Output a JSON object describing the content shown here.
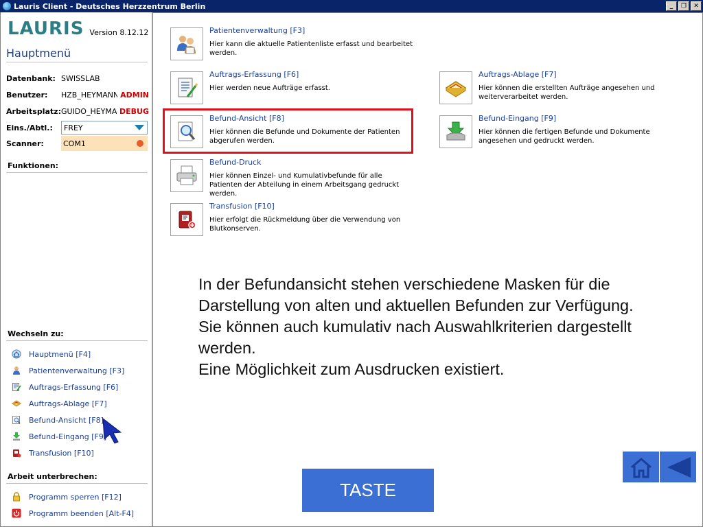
{
  "window": {
    "title": "Lauris Client - Deutsches Herzzentrum Berlin",
    "buttons": [
      "_",
      "❐",
      "✕"
    ]
  },
  "sidebar": {
    "logo": "LAURIS",
    "version": "Version 8.12.12",
    "heading": "Hauptmenü",
    "info": {
      "datenbank_label": "Datenbank:",
      "datenbank_value": "SWISSLAB",
      "benutzer_label": "Benutzer:",
      "benutzer_value": "HZB_HEYMANNG",
      "benutzer_badge": "ADMIN",
      "arbeitsplatz_label": "Arbeitsplatz:",
      "arbeitsplatz_value": "GUIDO_HEYMAN",
      "arbeitsplatz_badge": "DEBUG",
      "eins_label": "Eins./Abtl.:",
      "eins_value": "FREY",
      "scanner_label": "Scanner:",
      "scanner_value": "COM1"
    },
    "funktionen_label": "Funktionen:",
    "wechseln_label": "Wechseln zu:",
    "wechseln_items": [
      "Hauptmenü [F4]",
      "Patientenverwaltung [F3]",
      "Auftrags-Erfassung [F6]",
      "Auftrags-Ablage [F7]",
      "Befund-Ansicht [F8]",
      "Befund-Eingang [F9]",
      "Transfusion [F10]"
    ],
    "unterbrechen_label": "Arbeit unterbrechen:",
    "unterbrechen_items": [
      "Programm sperren [F12]",
      "Programm beenden [Alt-F4]"
    ]
  },
  "main": {
    "tiles": {
      "patientenverwaltung": {
        "title": "Patientenverwaltung [F3]",
        "desc": "Hier kann die aktuelle Patientenliste erfasst und bearbeitet werden."
      },
      "auftrags_erfassung": {
        "title": "Auftrags-Erfassung [F6]",
        "desc": "Hier werden neue Aufträge erfasst."
      },
      "auftrags_ablage": {
        "title": "Auftrags-Ablage [F7]",
        "desc": "Hier können die erstellten Aufträge angesehen und weiterverarbeitet werden."
      },
      "befund_ansicht": {
        "title": "Befund-Ansicht [F8]",
        "desc": "Hier können die Befunde und Dokumente der Patienten abgerufen werden."
      },
      "befund_eingang": {
        "title": "Befund-Eingang [F9]",
        "desc": "Hier können die fertigen Befunde und Dokumente angesehen und gedruckt werden."
      },
      "befund_druck": {
        "title": "Befund-Druck",
        "desc": "Hier können Einzel- und Kumulativbefunde für alle Patienten der Abteilung in einem Arbeitsgang gedruckt werden."
      },
      "transfusion": {
        "title": "Transfusion [F10]",
        "desc": "Hier erfolgt die Rückmeldung über die Verwendung von Blutkonserven."
      }
    },
    "overlay_lines": [
      "In der Befundansicht stehen verschiedene Masken für die",
      "Darstellung von alten und aktuellen Befunden zur Verfügung.",
      "Sie können auch kumulativ nach Auswahlkriterien dargestellt",
      "werden.",
      "Eine Möglichkeit zum Ausdrucken existiert."
    ],
    "taste_label": "TASTE"
  },
  "colors": {
    "accent": "#3b6fd4",
    "highlight": "#e0101a",
    "link": "#1a3f9a"
  }
}
